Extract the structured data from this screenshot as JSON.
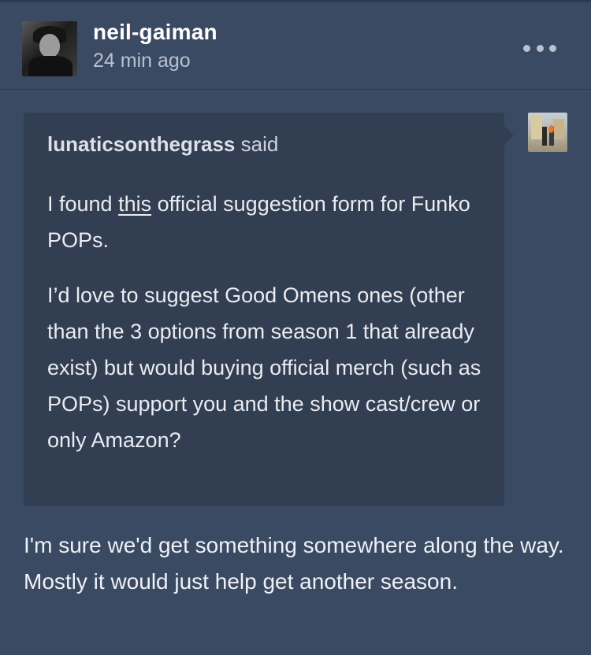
{
  "post": {
    "author": "neil-gaiman",
    "time": "24 min ago"
  },
  "quote": {
    "author": "lunaticsonthegrass",
    "said": "said",
    "p1_before": "I found ",
    "p1_link": "this",
    "p1_after": " official suggestion form for Funko POPs.",
    "p2": "I’d love to suggest Good Omens ones (other than the 3 options from season 1 that already exist) but would buying official merch (such as POPs) support you and the show cast/crew or only Amazon?"
  },
  "reply": {
    "text": "I'm sure we'd get something somewhere along the way. Mostly it would just help get another season."
  },
  "icons": {
    "more": "more-horizontal-icon"
  },
  "colors": {
    "background": "#3b4a63",
    "quote_background": "#323e52",
    "muted_text": "#b9c1cf"
  }
}
